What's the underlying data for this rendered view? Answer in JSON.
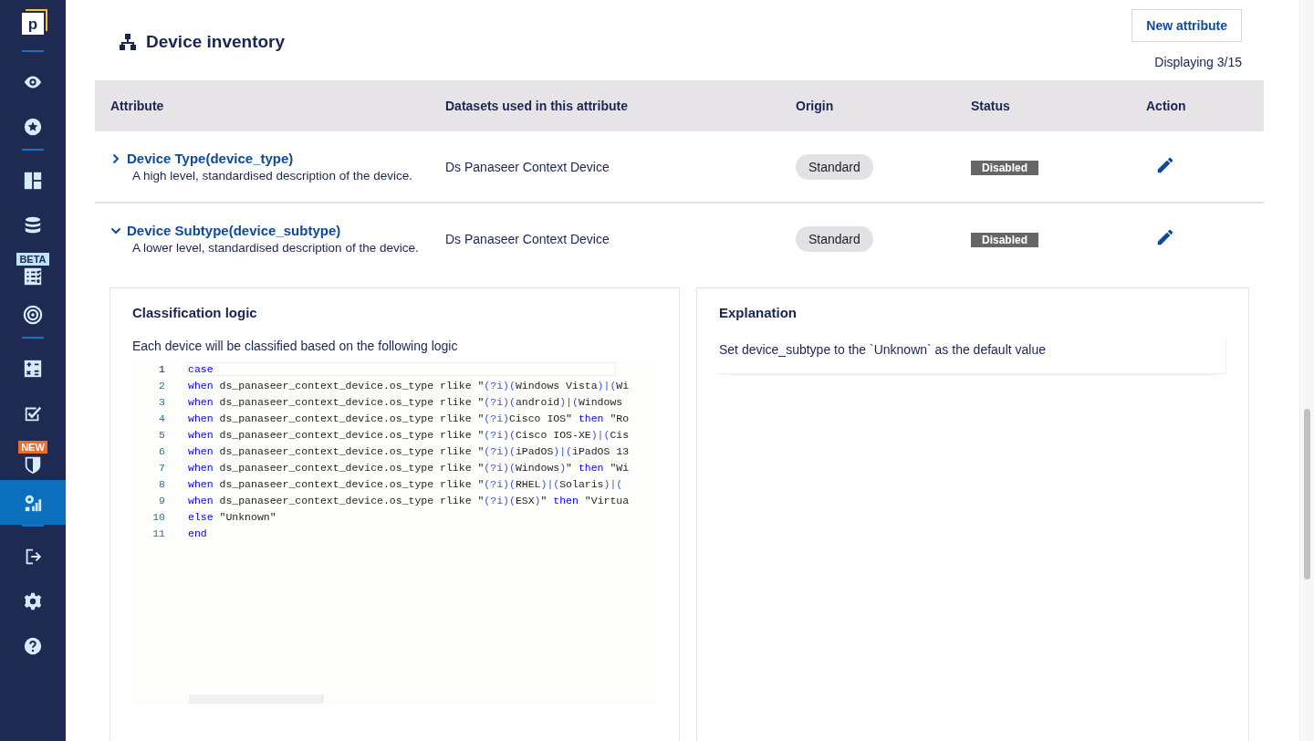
{
  "sidebar": {
    "logo": "p",
    "groups": [
      [
        {
          "selected": false
        },
        {
          "selected": false
        }
      ],
      [
        {
          "selected": false
        },
        {
          "selected": false
        },
        {
          "selected": false,
          "badge": "BETA",
          "color": "#bde3f8"
        },
        {
          "selected": false
        }
      ],
      [
        {
          "selected": false
        },
        {
          "selected": false
        },
        {
          "selected": false,
          "badge": "NEW",
          "color": "#f26b24"
        },
        {
          "selected": true
        }
      ],
      [
        {
          "selected": false
        },
        {
          "selected": false
        },
        {
          "selected": false
        }
      ]
    ]
  },
  "header": {
    "title": "Device inventory",
    "button": "New attribute",
    "count": "Displaying 3/15"
  },
  "table": {
    "columns": [
      "Attribute",
      "Datasets used in this attribute",
      "Origin",
      "Status",
      "Action"
    ],
    "rows": [
      {
        "name": "Device Type(device_type)",
        "description": "A high level, standardised description of the device.",
        "dataset": "Ds Panaseer Context Device",
        "origin": "Standard",
        "status": "Disabled",
        "expanded": false
      },
      {
        "name": "Device Subtype(device_subtype)",
        "description": "A lower level, standardised description of the device.",
        "dataset": "Ds Panaseer Context Device",
        "origin": "Standard",
        "status": "Disabled",
        "expanded": true
      }
    ]
  },
  "classification": {
    "title": "Classification logic",
    "intro": "Each device will be classified based on the following logic",
    "lines": [
      {
        "number": "1",
        "active": true,
        "tokens": [
          {
            "kind": "keyword",
            "text": "case"
          }
        ]
      },
      {
        "number": "2",
        "active": false,
        "tokens": [
          {
            "kind": "keyword",
            "text": "when"
          },
          {
            "kind": "plain",
            "text": " ds_panaseer_context_device.os_type rlike \""
          },
          {
            "kind": "paren",
            "text": "(?i)("
          },
          {
            "kind": "plain",
            "text": "Windows Vista"
          },
          {
            "kind": "paren",
            "text": ")|("
          },
          {
            "kind": "plain",
            "text": "Wi"
          }
        ]
      },
      {
        "number": "3",
        "active": false,
        "tokens": [
          {
            "kind": "keyword",
            "text": "when"
          },
          {
            "kind": "plain",
            "text": " ds_panaseer_context_device.os_type rlike \""
          },
          {
            "kind": "paren",
            "text": "(?i)("
          },
          {
            "kind": "plain",
            "text": "android"
          },
          {
            "kind": "paren",
            "text": ")|("
          },
          {
            "kind": "plain",
            "text": "Windows"
          }
        ]
      },
      {
        "number": "4",
        "active": false,
        "tokens": [
          {
            "kind": "keyword",
            "text": "when"
          },
          {
            "kind": "plain",
            "text": " ds_panaseer_context_device.os_type rlike \""
          },
          {
            "kind": "paren",
            "text": "(?i)"
          },
          {
            "kind": "plain",
            "text": "Cisco IOS\" "
          },
          {
            "kind": "keyword",
            "text": "then"
          },
          {
            "kind": "plain",
            "text": " \"Ro"
          }
        ]
      },
      {
        "number": "5",
        "active": false,
        "tokens": [
          {
            "kind": "keyword",
            "text": "when"
          },
          {
            "kind": "plain",
            "text": " ds_panaseer_context_device.os_type rlike \""
          },
          {
            "kind": "paren",
            "text": "(?i)("
          },
          {
            "kind": "plain",
            "text": "Cisco IOS-XE"
          },
          {
            "kind": "paren",
            "text": ")|("
          },
          {
            "kind": "plain",
            "text": "Cis"
          }
        ]
      },
      {
        "number": "6",
        "active": false,
        "tokens": [
          {
            "kind": "keyword",
            "text": "when"
          },
          {
            "kind": "plain",
            "text": " ds_panaseer_context_device.os_type rlike \""
          },
          {
            "kind": "paren",
            "text": "(?i)("
          },
          {
            "kind": "plain",
            "text": "iPadOS"
          },
          {
            "kind": "paren",
            "text": ")|("
          },
          {
            "kind": "plain",
            "text": "iPadOS 13"
          }
        ]
      },
      {
        "number": "7",
        "active": false,
        "tokens": [
          {
            "kind": "keyword",
            "text": "when"
          },
          {
            "kind": "plain",
            "text": " ds_panaseer_context_device.os_type rlike \""
          },
          {
            "kind": "paren",
            "text": "(?i)("
          },
          {
            "kind": "plain",
            "text": "Windows"
          },
          {
            "kind": "paren",
            "text": ")"
          },
          {
            "kind": "plain",
            "text": "\" "
          },
          {
            "kind": "keyword",
            "text": "then"
          },
          {
            "kind": "plain",
            "text": " \"Wi"
          }
        ]
      },
      {
        "number": "8",
        "active": false,
        "tokens": [
          {
            "kind": "keyword",
            "text": "when"
          },
          {
            "kind": "plain",
            "text": " ds_panaseer_context_device.os_type rlike \""
          },
          {
            "kind": "paren",
            "text": "(?i)("
          },
          {
            "kind": "plain",
            "text": "RHEL"
          },
          {
            "kind": "paren",
            "text": ")|("
          },
          {
            "kind": "plain",
            "text": "Solaris"
          },
          {
            "kind": "paren",
            "text": ")|("
          }
        ]
      },
      {
        "number": "9",
        "active": false,
        "tokens": [
          {
            "kind": "keyword",
            "text": "when"
          },
          {
            "kind": "plain",
            "text": " ds_panaseer_context_device.os_type rlike \""
          },
          {
            "kind": "paren",
            "text": "(?i)("
          },
          {
            "kind": "plain",
            "text": "ESX"
          },
          {
            "kind": "paren",
            "text": ")"
          },
          {
            "kind": "plain",
            "text": "\" "
          },
          {
            "kind": "keyword",
            "text": "then"
          },
          {
            "kind": "plain",
            "text": " \"Virtua"
          }
        ]
      },
      {
        "number": "10",
        "active": false,
        "tokens": [
          {
            "kind": "keyword",
            "text": "else"
          },
          {
            "kind": "plain",
            "text": " \"Unknown\""
          }
        ]
      },
      {
        "number": "11",
        "active": false,
        "tokens": [
          {
            "kind": "keyword",
            "text": "end"
          }
        ]
      }
    ]
  },
  "explanation": {
    "title": "Explanation",
    "text": "Set device_subtype to the `Unknown` as the default value"
  }
}
